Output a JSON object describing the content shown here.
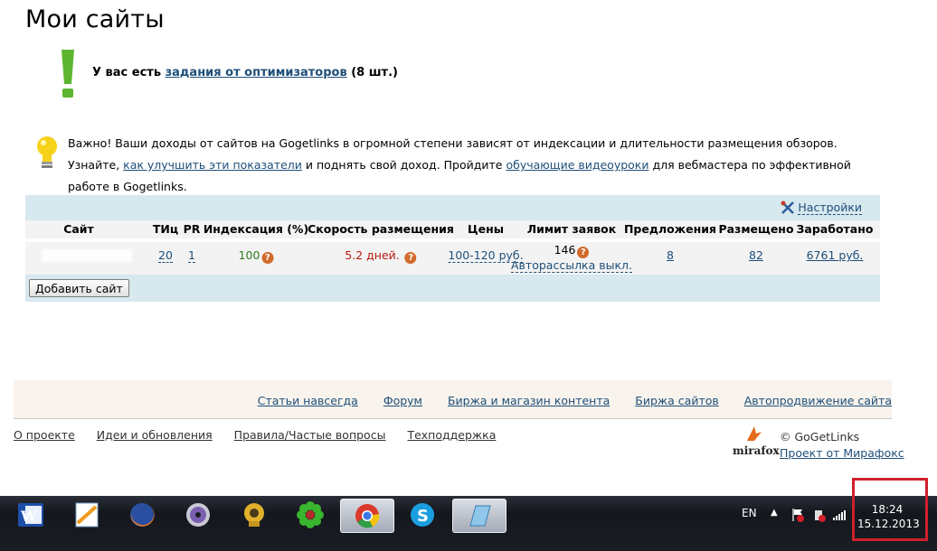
{
  "page": {
    "title": "Мои сайты"
  },
  "notice": {
    "prefix": "У вас есть ",
    "link": "задания от оптимизаторов",
    "suffix": " (8 шт.)"
  },
  "info": {
    "part1": "Важно! Ваши доходы от сайтов на Gogetlinks в огромной степени зависят от индексации и длительности размещения обзоров. Узнайте, ",
    "link1": "как улучшить эти показатели",
    "part2": " и поднять свой доход. Пройдите ",
    "link2": "обучающие видеоуроки",
    "part3": " для вебмастера по эффективной работе в Gogetlinks."
  },
  "sites_table": {
    "settings_label": "Настройки",
    "columns": [
      "Сайт",
      "ТИц",
      "PR",
      "Индексация (%)",
      "Скорость размещения",
      "Цены",
      "Лимит заявок",
      "Предложения",
      "Размещено",
      "Заработано"
    ],
    "rows": [
      {
        "site": "",
        "tic": "20",
        "pr": "1",
        "indexing": "100",
        "speed": "5.2 дней.",
        "prices": "100-120 руб.",
        "limit": "146",
        "auto_mailing": "Авторассылка выкл.",
        "offers": "8",
        "placed": "82",
        "earned": "6761 руб."
      }
    ],
    "add_button": "Добавить сайт",
    "help_glyph": "?"
  },
  "footer": {
    "top_links": [
      "Статьи навсегда",
      "Форум",
      "Биржа и магазин контента",
      "Биржа сайтов",
      "Автопродвижение сайта"
    ],
    "bottom_links": [
      "О проекте",
      "Идеи и обновления",
      "Правила/Частые вопросы",
      "Техподдержка"
    ],
    "copyright": "© GoGetLinks",
    "project_link": "Проект от Мирафокс",
    "logo_text": "mirafox"
  },
  "taskbar": {
    "apps": [
      "word-icon",
      "notes-icon",
      "firefox-icon",
      "dvd-icon",
      "icq-icon",
      "flower-icon",
      "chrome-icon",
      "skype-icon",
      "notepad-icon"
    ],
    "active_apps": [
      "chrome-icon",
      "notepad-icon"
    ],
    "lang": "EN",
    "time": "18:24",
    "date": "15.12.2013"
  },
  "colors": {
    "accent": "#d7e8ee",
    "highlight_box": "#d0202b",
    "link": "#1f4f7a"
  }
}
